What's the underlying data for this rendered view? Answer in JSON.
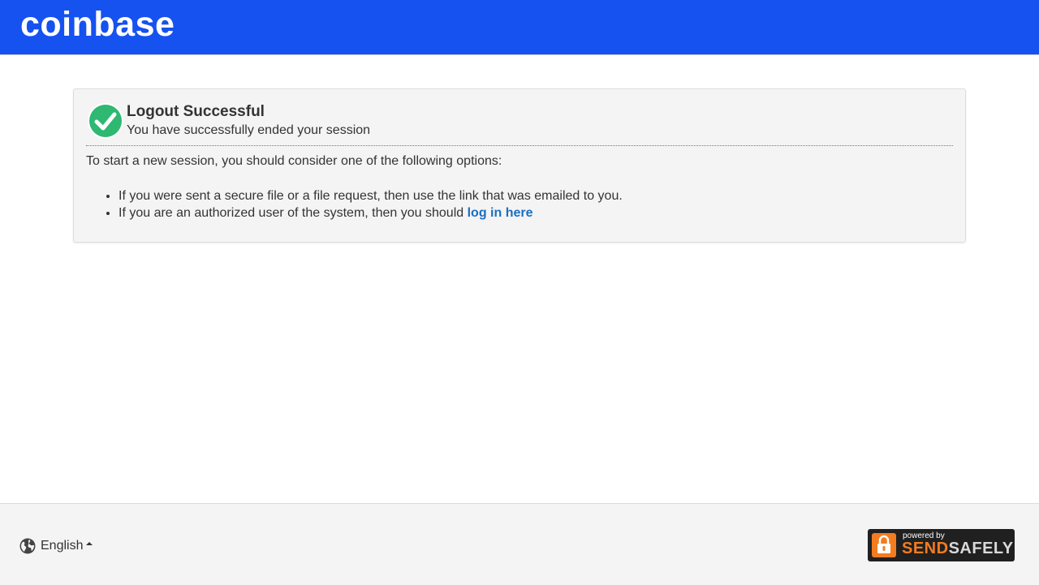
{
  "header": {
    "logo_text": "coinbase",
    "brand_color": "#1652f0"
  },
  "panel": {
    "icon": "check-circle-icon",
    "title": "Logout Successful",
    "subtitle": "You have successfully ended your session",
    "intro": "To start a new session, you should consider one of the following options:",
    "options": [
      {
        "text": "If you were sent a secure file or a file request, then use the link that was emailed to you."
      },
      {
        "text": "If you are an authorized user of the system, then you should ",
        "link_text": "log in here"
      }
    ]
  },
  "footer": {
    "language": "English",
    "globe_icon": "globe-icon",
    "caret_icon": "caret-up-icon",
    "badge": {
      "powered_by": "powered by",
      "brand_send": "SEND",
      "brand_safely": "SAFELY",
      "icon": "lock-icon"
    }
  },
  "colors": {
    "accent": "#1652f0",
    "link": "#1a6fc2",
    "success": "#2eb872",
    "send_orange": "#f47c20"
  }
}
